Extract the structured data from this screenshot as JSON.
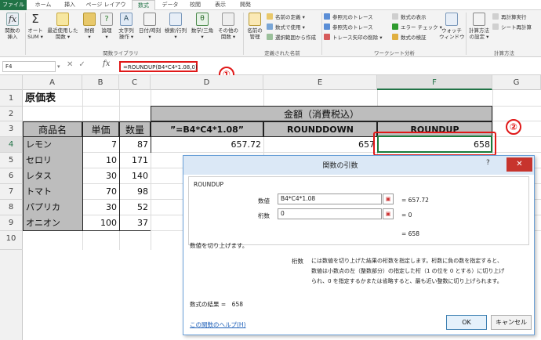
{
  "tabs": [
    "ファイル",
    "ホーム",
    "挿入",
    "ページ レイアウト",
    "数式",
    "データ",
    "校閲",
    "表示",
    "開発"
  ],
  "ribbon": {
    "big": [
      "関数の\n挿入",
      "オート\nSUM ▾",
      "最近使用した\n関数 ▾",
      "財務\n▾",
      "論理\n▾",
      "文字列\n操作 ▾",
      "日付/時刻\n▾",
      "検索/行列\n▾",
      "数学/三角\n▾",
      "その他の\n関数 ▾",
      "名前の\n管理",
      "ウォッチ\nウィンドウ",
      "計算方法\nの設定 ▾"
    ],
    "small": [
      "名前の定義 ▾",
      "数式で使用 ▾",
      "選択範囲から作成",
      "参照元のトレース",
      "参照先のトレース",
      "トレース矢印の削除 ▾",
      "数式の表示",
      "エラー チェック ▾",
      "数式の検証",
      "再計算実行",
      "シート再計算"
    ],
    "groups": [
      "関数ライブラリ",
      "定義された名前",
      "ワークシート分析",
      "計算方法"
    ]
  },
  "name_box": "F4",
  "formula": "=ROUNDUP(B4*C4*1.08,0)",
  "markers": [
    "①",
    "②"
  ],
  "columns": [
    "A",
    "B",
    "C",
    "D",
    "E",
    "F",
    "G"
  ],
  "rows": [
    "1",
    "2",
    "3",
    "4",
    "5",
    "6",
    "7",
    "8",
    "9",
    "10"
  ],
  "sheet": {
    "title": "原価表",
    "header_merged": "金額（消費税込）",
    "headers": [
      "商品名",
      "単価",
      "数量",
      "”=B4*C4*1.08”",
      "ROUNDDOWN",
      "ROUNDUP"
    ],
    "items": [
      {
        "name": "レモン",
        "price": "7",
        "qty": "87"
      },
      {
        "name": "セロリ",
        "price": "10",
        "qty": "171"
      },
      {
        "name": "レタス",
        "price": "30",
        "qty": "140"
      },
      {
        "name": "トマト",
        "price": "70",
        "qty": "98"
      },
      {
        "name": "パプリカ",
        "price": "30",
        "qty": "52"
      },
      {
        "name": "オニオン",
        "price": "100",
        "qty": "37"
      }
    ],
    "d4": "657.72",
    "e4": "657",
    "f4": "658"
  },
  "dialog": {
    "title": "関数の引数",
    "q": "?",
    "close": "✕",
    "func": "ROUNDUP",
    "arg1_label": "数値",
    "arg1_value": "B4*C4*1.08",
    "arg1_result": "= 657.72",
    "arg2_label": "桁数",
    "arg2_value": "0",
    "arg2_result": "= 0",
    "result": "= 658",
    "desc": "数値を切り上げます。",
    "arg_desc_label": "桁数",
    "arg_desc1": "には数値を切り上げた結果の桁数を指定します。桁数に負の数を指定すると、",
    "arg_desc2": "数値は小数点の左（整数部分）の指定した桁（1 の位を 0 とする）に切り上げ",
    "arg_desc3": "られ、0 を指定するかまたは省略すると、最も近い整数に切り上げられます。",
    "formula_result": "数式の結果 =　658",
    "help": "この関数のヘルプ(H)",
    "ok": "OK",
    "cancel": "キャンセル"
  }
}
